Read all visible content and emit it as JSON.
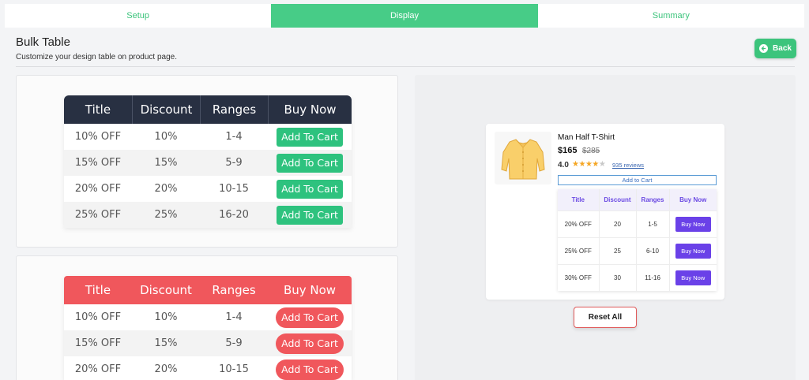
{
  "tabs": [
    {
      "label": "Setup"
    },
    {
      "label": "Display"
    },
    {
      "label": "Summary"
    }
  ],
  "header": {
    "title": "Bulk Table",
    "subtitle": "Customize your design table on product page.",
    "back_label": "Back"
  },
  "design_tables": {
    "headers": [
      "Title",
      "Discount",
      "Ranges",
      "Buy Now"
    ],
    "dark_rows": [
      {
        "title": "10% OFF",
        "discount": "10%",
        "range": "1-4",
        "button": "Add To Cart"
      },
      {
        "title": "15% OFF",
        "discount": "15%",
        "range": "5-9",
        "button": "Add To Cart"
      },
      {
        "title": "20% OFF",
        "discount": "20%",
        "range": "10-15",
        "button": "Add To Cart"
      },
      {
        "title": "25% OFF",
        "discount": "25%",
        "range": "16-20",
        "button": "Add To Cart"
      }
    ],
    "red_rows": [
      {
        "title": "10% OFF",
        "discount": "10%",
        "range": "1-4",
        "button": "Add To Cart"
      },
      {
        "title": "15% OFF",
        "discount": "15%",
        "range": "5-9",
        "button": "Add To Cart"
      },
      {
        "title": "20% OFF",
        "discount": "20%",
        "range": "10-15",
        "button": "Add To Cart"
      }
    ]
  },
  "preview": {
    "product_name": "Man Half T-Shirt",
    "price": "$165",
    "old_price": "$285",
    "rating": "4.0",
    "stars_filled": 4,
    "stars_total": 5,
    "reviews": "935 reviews",
    "add_to_cart": "Add to Cart",
    "headers": [
      "Title",
      "Discount",
      "Ranges",
      "Buy Now"
    ],
    "rows": [
      {
        "title": "20% OFF",
        "discount": "20",
        "range": "1-5",
        "button": "Buy Now"
      },
      {
        "title": "25% OFF",
        "discount": "25",
        "range": "6-10",
        "button": "Buy Now"
      },
      {
        "title": "30% OFF",
        "discount": "30",
        "range": "11-16",
        "button": "Buy Now"
      }
    ]
  },
  "reset_label": "Reset All",
  "colors": {
    "accent_green": "#47cc87",
    "dark_header": "#283042",
    "red_header": "#f0575c",
    "purple": "#6a41e8"
  }
}
